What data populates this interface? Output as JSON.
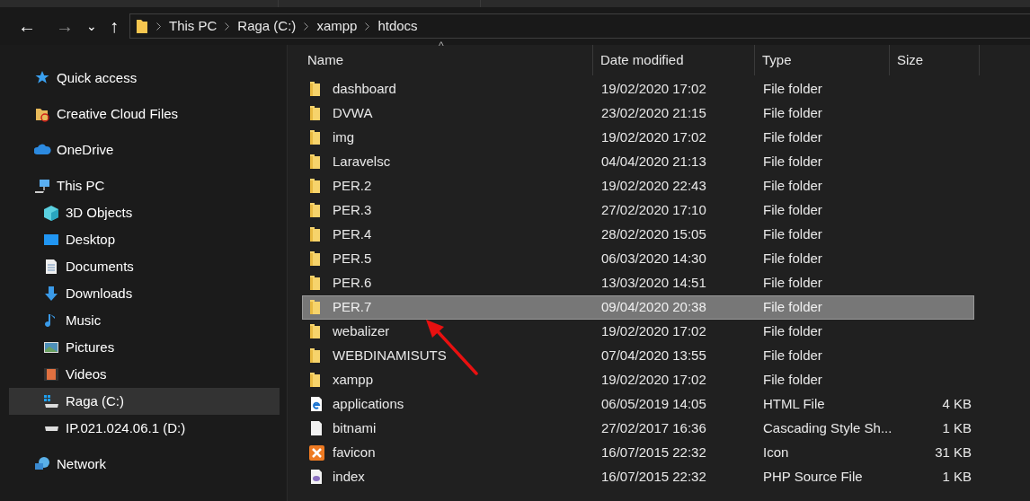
{
  "navigation": {
    "back": "←",
    "forward": "→",
    "recent": "⌄",
    "up": "↑"
  },
  "breadcrumb": [
    "This PC",
    "Raga (C:)",
    "xampp",
    "htdocs"
  ],
  "sidebar": {
    "items": [
      {
        "label": "Quick access",
        "kind": "star",
        "selected": false
      },
      {
        "label": "Creative Cloud Files",
        "kind": "cloudfolder",
        "selected": false
      },
      {
        "label": "OneDrive",
        "kind": "cloud",
        "selected": false
      },
      {
        "label": "This PC",
        "kind": "pc",
        "selected": false,
        "children": [
          {
            "label": "3D Objects",
            "kind": "cube",
            "selected": false
          },
          {
            "label": "Desktop",
            "kind": "desktop",
            "selected": false
          },
          {
            "label": "Documents",
            "kind": "document",
            "selected": false
          },
          {
            "label": "Downloads",
            "kind": "download",
            "selected": false
          },
          {
            "label": "Music",
            "kind": "music",
            "selected": false
          },
          {
            "label": "Pictures",
            "kind": "picture",
            "selected": false
          },
          {
            "label": "Videos",
            "kind": "video",
            "selected": false
          },
          {
            "label": "Raga (C:)",
            "kind": "systemdrive",
            "selected": true
          },
          {
            "label": "IP.021.024.06.1 (D:)",
            "kind": "drive",
            "selected": false
          }
        ]
      },
      {
        "label": "Network",
        "kind": "network",
        "selected": false
      }
    ]
  },
  "table": {
    "sort_indicator": "^",
    "columns": [
      "Name",
      "Date modified",
      "Type",
      "Size"
    ],
    "rows": [
      {
        "name": "dashboard",
        "date": "19/02/2020 17:02",
        "type": "File folder",
        "size": "",
        "kind": "folder",
        "selected": false
      },
      {
        "name": "DVWA",
        "date": "23/02/2020 21:15",
        "type": "File folder",
        "size": "",
        "kind": "folder",
        "selected": false
      },
      {
        "name": "img",
        "date": "19/02/2020 17:02",
        "type": "File folder",
        "size": "",
        "kind": "folder",
        "selected": false
      },
      {
        "name": "Laravelsc",
        "date": "04/04/2020 21:13",
        "type": "File folder",
        "size": "",
        "kind": "folder",
        "selected": false
      },
      {
        "name": "PER.2",
        "date": "19/02/2020 22:43",
        "type": "File folder",
        "size": "",
        "kind": "folder",
        "selected": false
      },
      {
        "name": "PER.3",
        "date": "27/02/2020 17:10",
        "type": "File folder",
        "size": "",
        "kind": "folder",
        "selected": false
      },
      {
        "name": "PER.4",
        "date": "28/02/2020 15:05",
        "type": "File folder",
        "size": "",
        "kind": "folder",
        "selected": false
      },
      {
        "name": "PER.5",
        "date": "06/03/2020 14:30",
        "type": "File folder",
        "size": "",
        "kind": "folder",
        "selected": false
      },
      {
        "name": "PER.6",
        "date": "13/03/2020 14:51",
        "type": "File folder",
        "size": "",
        "kind": "folder",
        "selected": false
      },
      {
        "name": "PER.7",
        "date": "09/04/2020 20:38",
        "type": "File folder",
        "size": "",
        "kind": "folder",
        "selected": true
      },
      {
        "name": "webalizer",
        "date": "19/02/2020 17:02",
        "type": "File folder",
        "size": "",
        "kind": "folder",
        "selected": false
      },
      {
        "name": "WEBDINAMISUTS",
        "date": "07/04/2020 13:55",
        "type": "File folder",
        "size": "",
        "kind": "folder",
        "selected": false
      },
      {
        "name": "xampp",
        "date": "19/02/2020 17:02",
        "type": "File folder",
        "size": "",
        "kind": "folder",
        "selected": false
      },
      {
        "name": "applications",
        "date": "06/05/2019 14:05",
        "type": "HTML File",
        "size": "4 KB",
        "kind": "html",
        "selected": false
      },
      {
        "name": "bitnami",
        "date": "27/02/2017 16:36",
        "type": "Cascading Style Sh...",
        "size": "1 KB",
        "kind": "css",
        "selected": false
      },
      {
        "name": "favicon",
        "date": "16/07/2015 22:32",
        "type": "Icon",
        "size": "31 KB",
        "kind": "xampp",
        "selected": false
      },
      {
        "name": "index",
        "date": "16/07/2015 22:32",
        "type": "PHP Source File",
        "size": "1 KB",
        "kind": "php",
        "selected": false
      }
    ]
  }
}
